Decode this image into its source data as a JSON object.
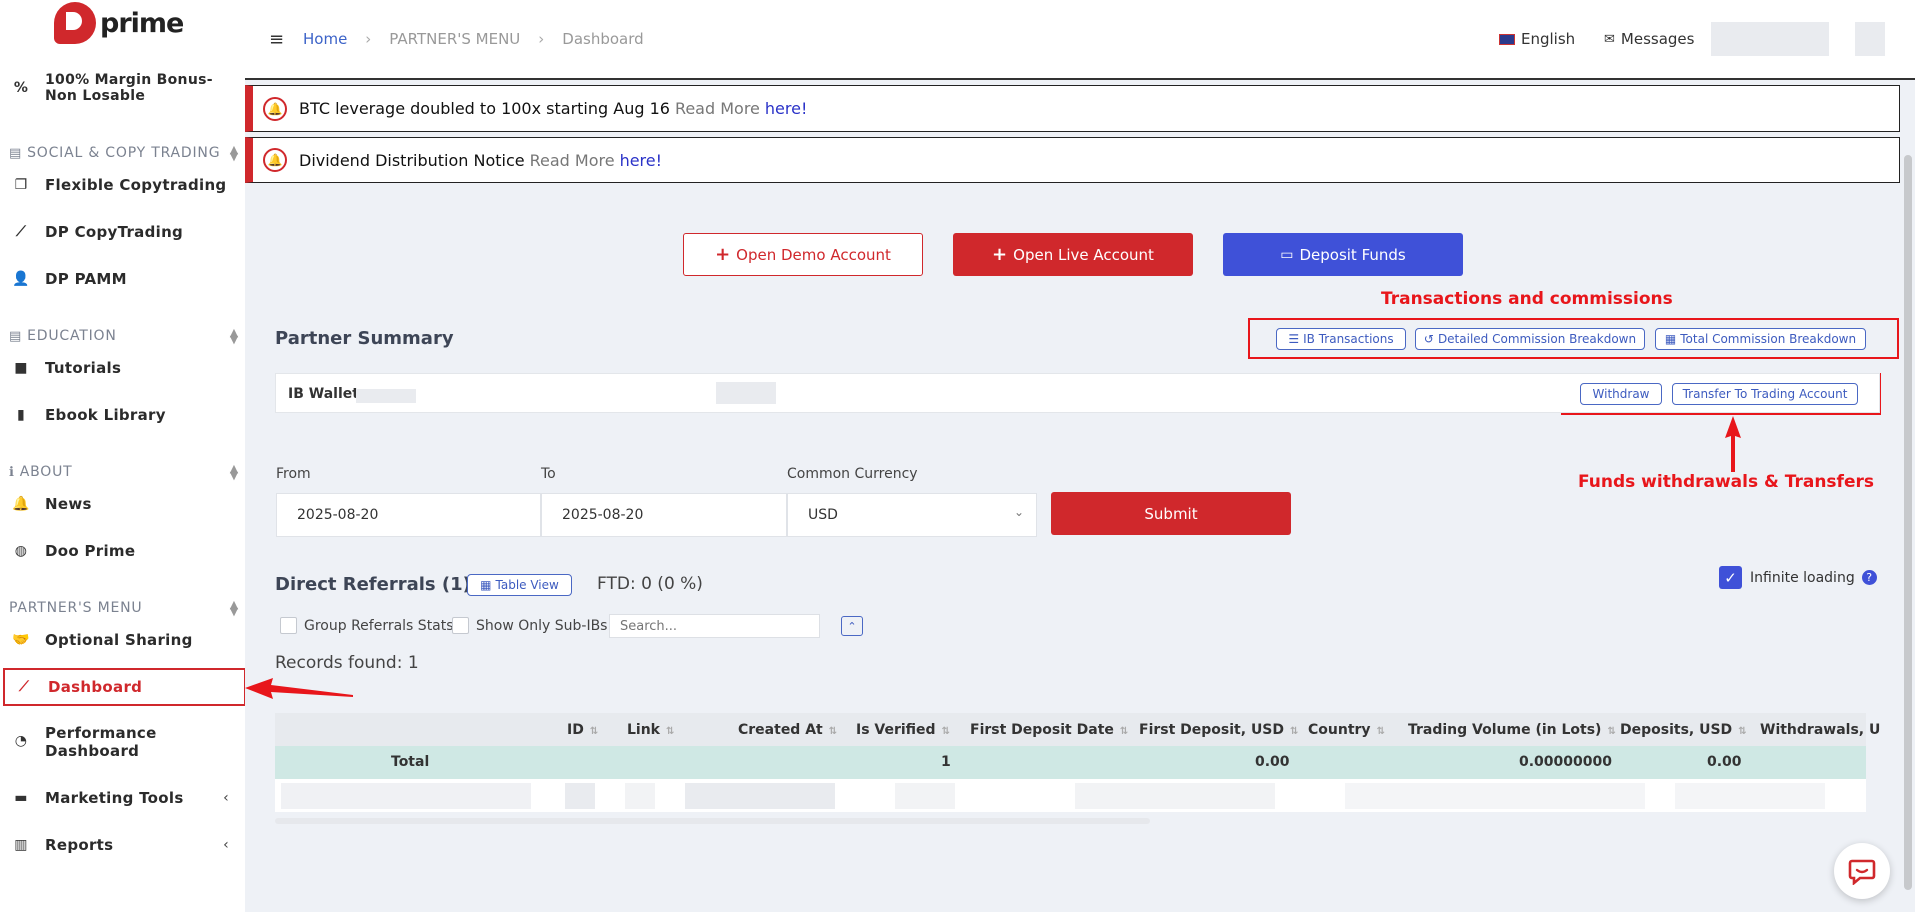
{
  "brand": {
    "name": "prime",
    "color": "#d0282c"
  },
  "sidebar": {
    "items": [
      {
        "label": "100% Margin Bonus- Non Losable",
        "icon": "percent-icon"
      },
      {
        "section": "SOCIAL & COPY TRADING"
      },
      {
        "label": "Flexible Copytrading",
        "icon": "copy-icon"
      },
      {
        "label": "DP CopyTrading",
        "icon": "chart-line-icon"
      },
      {
        "label": "DP PAMM",
        "icon": "user-plus-icon"
      },
      {
        "section": "EDUCATION"
      },
      {
        "label": "Tutorials",
        "icon": "video-icon"
      },
      {
        "label": "Ebook Library",
        "icon": "book-icon"
      },
      {
        "section": "ABOUT"
      },
      {
        "label": "News",
        "icon": "bell-icon"
      },
      {
        "label": "Doo Prime",
        "icon": "globe-icon"
      },
      {
        "section": "PARTNER'S MENU"
      },
      {
        "label": "Optional Sharing",
        "icon": "handshake-icon"
      },
      {
        "label": "Dashboard",
        "icon": "chart-line-icon",
        "active": true
      },
      {
        "label": "Performance Dashboard",
        "icon": "pie-chart-icon"
      },
      {
        "label": "Marketing Tools",
        "icon": "briefcase-icon"
      },
      {
        "label": "Reports",
        "icon": "bar-chart-icon"
      }
    ]
  },
  "header": {
    "breadcrumb": [
      "Home",
      "PARTNER'S MENU",
      "Dashboard"
    ],
    "language": "English",
    "messages": "Messages"
  },
  "notices": [
    {
      "text": "BTC leverage doubled to 100x starting Aug 16",
      "read_more": "Read More",
      "link": "here!"
    },
    {
      "text": "Dividend Distribution Notice",
      "read_more": "Read More",
      "link": "here!"
    }
  ],
  "actions": {
    "open_demo": "Open Demo Account",
    "open_live": "Open Live Account",
    "deposit": "Deposit Funds"
  },
  "annotations": {
    "transactions": "Transactions and commissions",
    "funds": "Funds withdrawals & Transfers"
  },
  "partner_summary": {
    "title": "Partner Summary",
    "ib_transactions": "IB Transactions",
    "detailed_breakdown": "Detailed Commission Breakdown",
    "total_breakdown": "Total Commission Breakdown",
    "wallet_label": "IB Wallet",
    "withdraw": "Withdraw",
    "transfer": "Transfer To Trading Account"
  },
  "filters": {
    "from_label": "From",
    "from_value": "2025-08-20",
    "to_label": "To",
    "to_value": "2025-08-20",
    "currency_label": "Common Currency",
    "currency_value": "USD",
    "submit": "Submit"
  },
  "referrals": {
    "title": "Direct Referrals (1)",
    "table_view": "Table View",
    "ftd": "FTD: 0 (0 %)",
    "infinite_loading": "Infinite loading",
    "group_stats": "Group Referrals Stats",
    "only_sub_ibs": "Show Only Sub-IBs",
    "search_placeholder": "Search...",
    "records": "Records found: 1",
    "columns": [
      "ID",
      "Link",
      "Created At",
      "Is Verified",
      "First Deposit Date",
      "First Deposit, USD",
      "Country",
      "Trading Volume (in Lots)",
      "Deposits, USD",
      "Withdrawals, U"
    ],
    "total_row": {
      "label": "Total",
      "is_verified": "1",
      "first_deposit": "0.00",
      "volume": "0.00000000",
      "deposits": "0.00"
    }
  }
}
